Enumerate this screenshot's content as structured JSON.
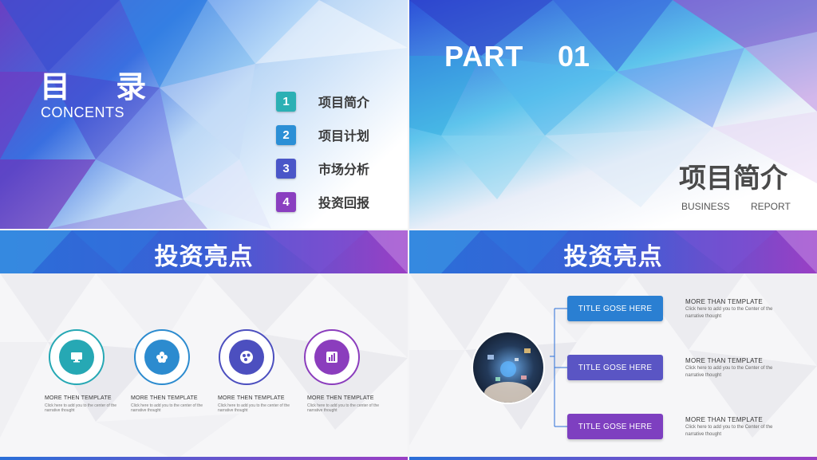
{
  "slide1": {
    "title": "目 录",
    "subtitle": "CONCENTS",
    "items": [
      {
        "num": "1",
        "label": "项目简介",
        "color": "#2bb0b4"
      },
      {
        "num": "2",
        "label": "项目计划",
        "color": "#2b8fd6"
      },
      {
        "num": "3",
        "label": "市场分析",
        "color": "#4a56c8"
      },
      {
        "num": "4",
        "label": "投资回报",
        "color": "#8a3fc0"
      }
    ]
  },
  "slide2": {
    "part_word": "PART",
    "part_num": "01",
    "title": "项目简介",
    "sub_left": "BUSINESS",
    "sub_right": "REPORT"
  },
  "slide3": {
    "header": "投资亮点",
    "items": [
      {
        "icon": "monitor-icon",
        "color": "#26a8b4",
        "title": "MORE THEN TEMPLATE",
        "desc": "Click here to add  you to the center of the  narrative thought"
      },
      {
        "icon": "flower-icon",
        "color": "#2c8bcf",
        "title": "MORE THEN TEMPLATE",
        "desc": "Click here to add  you to the center of the  narrative thought"
      },
      {
        "icon": "dots-icon",
        "color": "#4c4fbf",
        "title": "MORE THEN TEMPLATE",
        "desc": "Click here to add  you to the center of the  narrative thought"
      },
      {
        "icon": "bar-chart-icon",
        "color": "#8b3dbd",
        "title": "MORE THEN TEMPLATE",
        "desc": "Click here to add  you to the center of the  narrative thought"
      }
    ]
  },
  "slide4": {
    "header": "投资亮点",
    "items": [
      {
        "button": "TITLE GOSE HERE",
        "color": "#2a7fd2",
        "title": "MORE THAN TEMPLATE",
        "desc": "Click here to add  you to the Center of the  narrative thought"
      },
      {
        "button": "TITLE GOSE HERE",
        "color": "#5a55c4",
        "title": "MORE THAN TEMPLATE",
        "desc": "Click here to add  you to the Center of the  narrative thought"
      },
      {
        "button": "TITLE GOSE HERE",
        "color": "#7e3fc0",
        "title": "MORE THAN TEMPLATE",
        "desc": "Click here to add  you to the Center of the  narrative thought"
      }
    ]
  }
}
